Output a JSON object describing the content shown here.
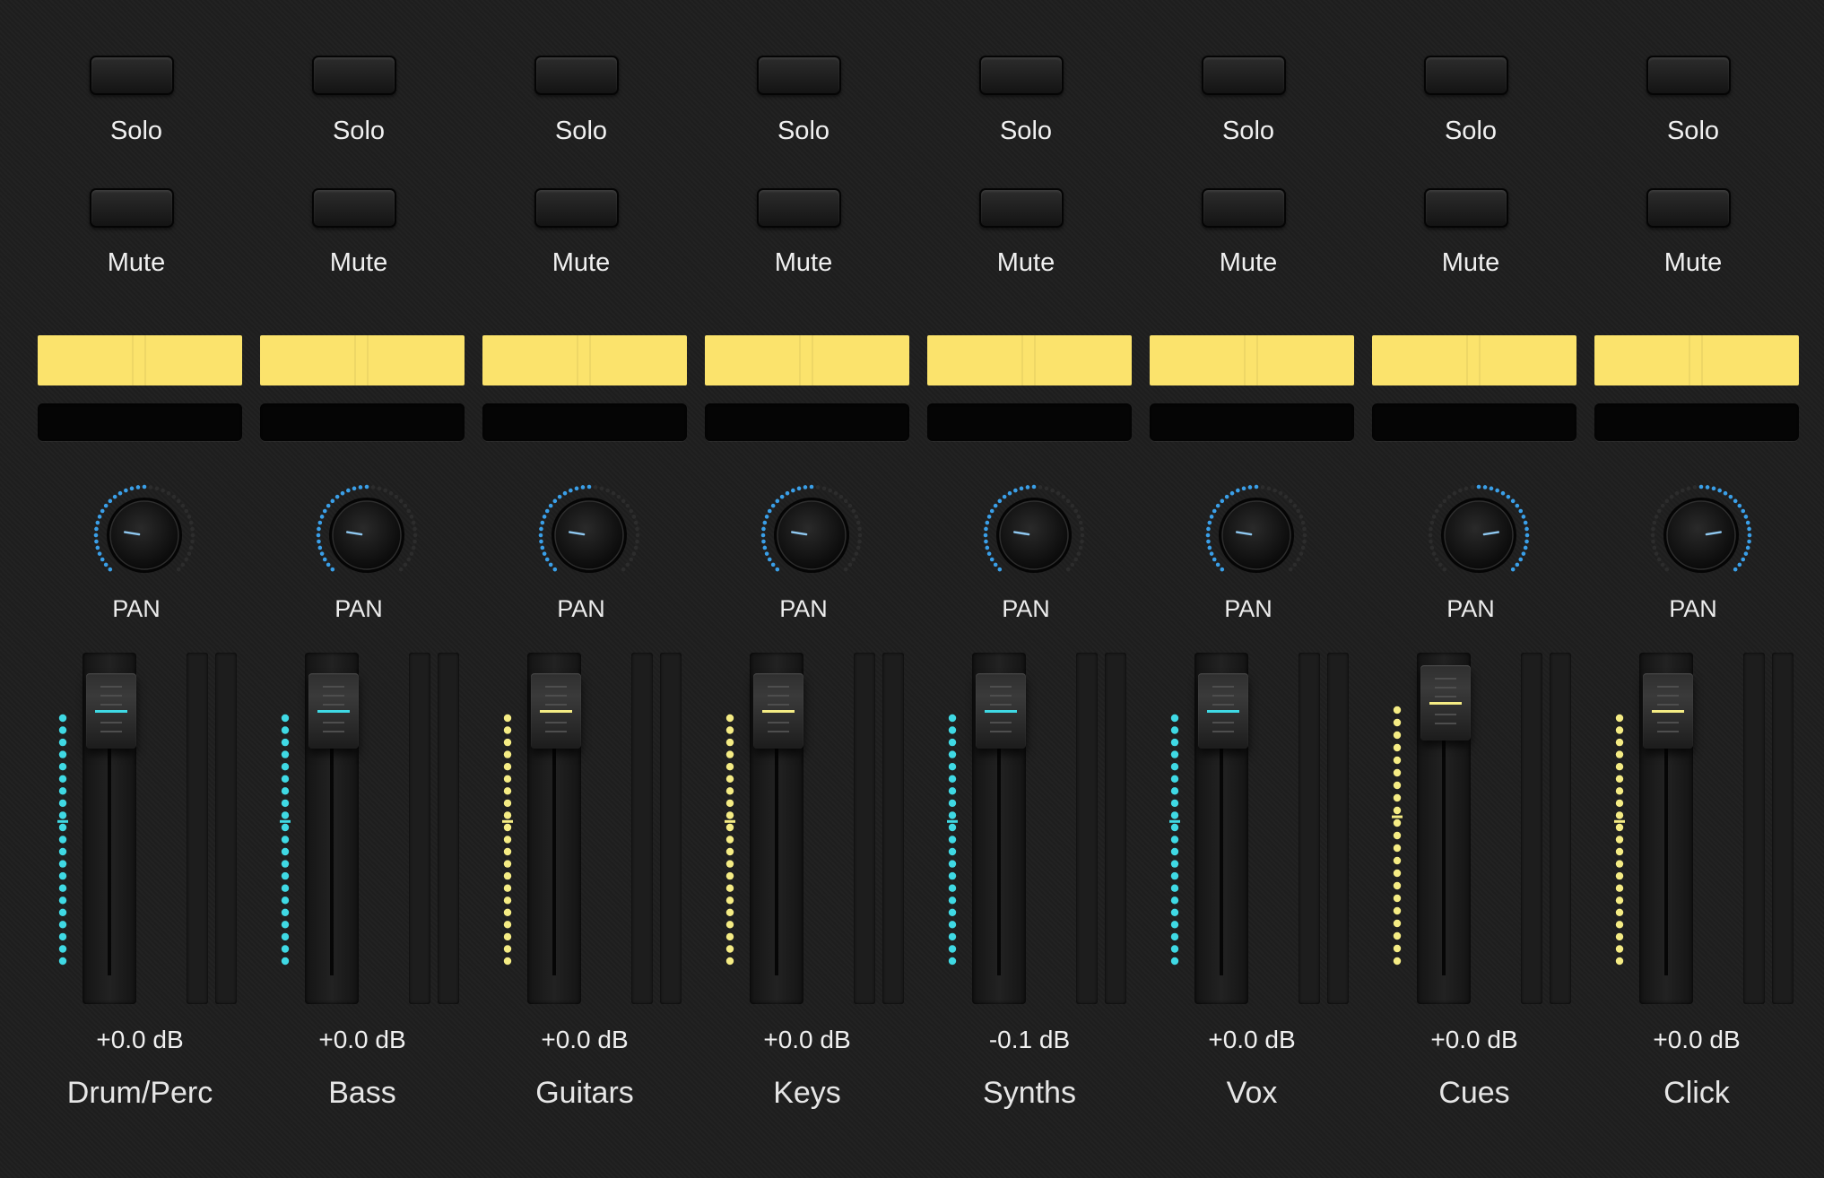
{
  "channels": [
    {
      "name": "Drum/Perc",
      "solo_label": "Solo",
      "mute_label": "Mute",
      "pan_label": "PAN",
      "gain": "+0.0 dB",
      "pan_value": -0.6,
      "fader_level": 0.9,
      "accent": "#3fd9e4",
      "lcd_color": "#fbe36c"
    },
    {
      "name": "Bass",
      "solo_label": "Solo",
      "mute_label": "Mute",
      "pan_label": "PAN",
      "gain": "+0.0 dB",
      "pan_value": -0.6,
      "fader_level": 0.9,
      "accent": "#3fd9e4",
      "lcd_color": "#fbe36c"
    },
    {
      "name": "Guitars",
      "solo_label": "Solo",
      "mute_label": "Mute",
      "pan_label": "PAN",
      "gain": "+0.0 dB",
      "pan_value": -0.6,
      "fader_level": 0.9,
      "accent": "#f5ec84",
      "lcd_color": "#fbe36c"
    },
    {
      "name": "Keys",
      "solo_label": "Solo",
      "mute_label": "Mute",
      "pan_label": "PAN",
      "gain": "+0.0 dB",
      "pan_value": -0.6,
      "fader_level": 0.9,
      "accent": "#f5ec84",
      "lcd_color": "#fbe36c"
    },
    {
      "name": "Synths",
      "solo_label": "Solo",
      "mute_label": "Mute",
      "pan_label": "PAN",
      "gain": "-0.1 dB",
      "pan_value": -0.6,
      "fader_level": 0.9,
      "accent": "#3fd9e4",
      "lcd_color": "#fbe36c"
    },
    {
      "name": "Vox",
      "solo_label": "Solo",
      "mute_label": "Mute",
      "pan_label": "PAN",
      "gain": "+0.0 dB",
      "pan_value": -0.6,
      "fader_level": 0.9,
      "accent": "#3fd9e4",
      "lcd_color": "#fbe36c"
    },
    {
      "name": "Cues",
      "solo_label": "Solo",
      "mute_label": "Mute",
      "pan_label": "PAN",
      "gain": "+0.0 dB",
      "pan_value": 0.6,
      "fader_level": 0.93,
      "accent": "#f5ec84",
      "lcd_color": "#fbe36c"
    },
    {
      "name": "Click",
      "solo_label": "Solo",
      "mute_label": "Mute",
      "pan_label": "PAN",
      "gain": "+0.0 dB",
      "pan_value": 0.6,
      "fader_level": 0.9,
      "accent": "#f5ec84",
      "lcd_color": "#fbe36c"
    }
  ],
  "icons": {
    "pan": "pan-knob-icon"
  }
}
